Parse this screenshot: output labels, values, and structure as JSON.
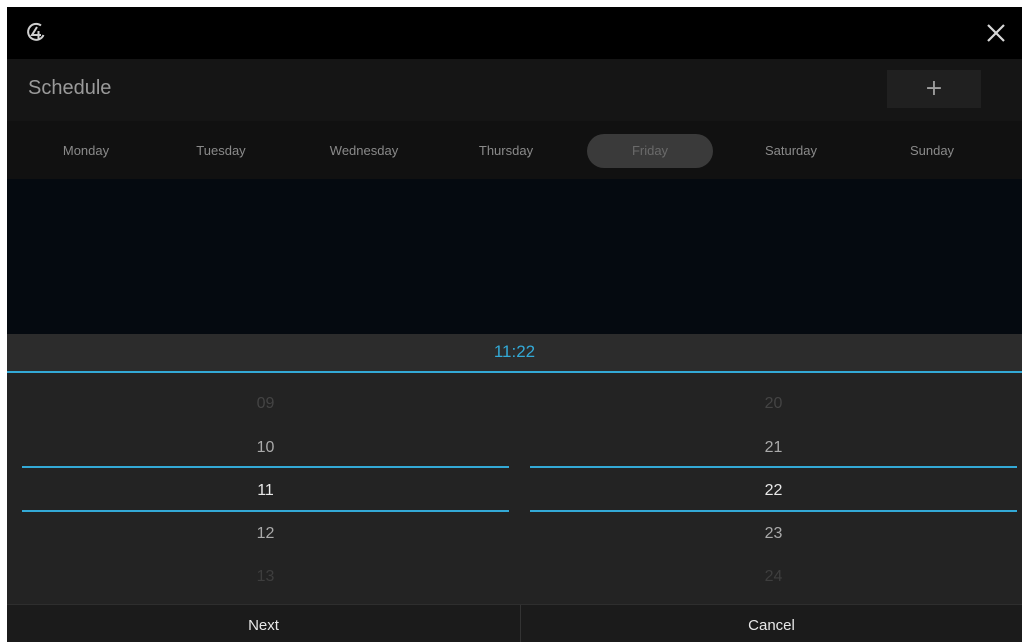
{
  "header": {
    "logo_icon": "brand-logo-icon",
    "close_icon": "close-icon"
  },
  "schedule": {
    "title": "Schedule",
    "add_label": "+"
  },
  "days": [
    {
      "label": "Monday"
    },
    {
      "label": "Tuesday"
    },
    {
      "label": "Wednesday"
    },
    {
      "label": "Thursday"
    },
    {
      "label": "Friday",
      "selected": true
    },
    {
      "label": "Saturday"
    },
    {
      "label": "Sunday"
    }
  ],
  "time_picker": {
    "value": "11:22",
    "hours": [
      "09",
      "10",
      "11",
      "12",
      "13"
    ],
    "minutes": [
      "20",
      "21",
      "22",
      "23",
      "24"
    ],
    "selected_hour": "11",
    "selected_minute": "22",
    "accent_color": "#33a9d6"
  },
  "actions": {
    "next_label": "Next",
    "cancel_label": "Cancel"
  }
}
